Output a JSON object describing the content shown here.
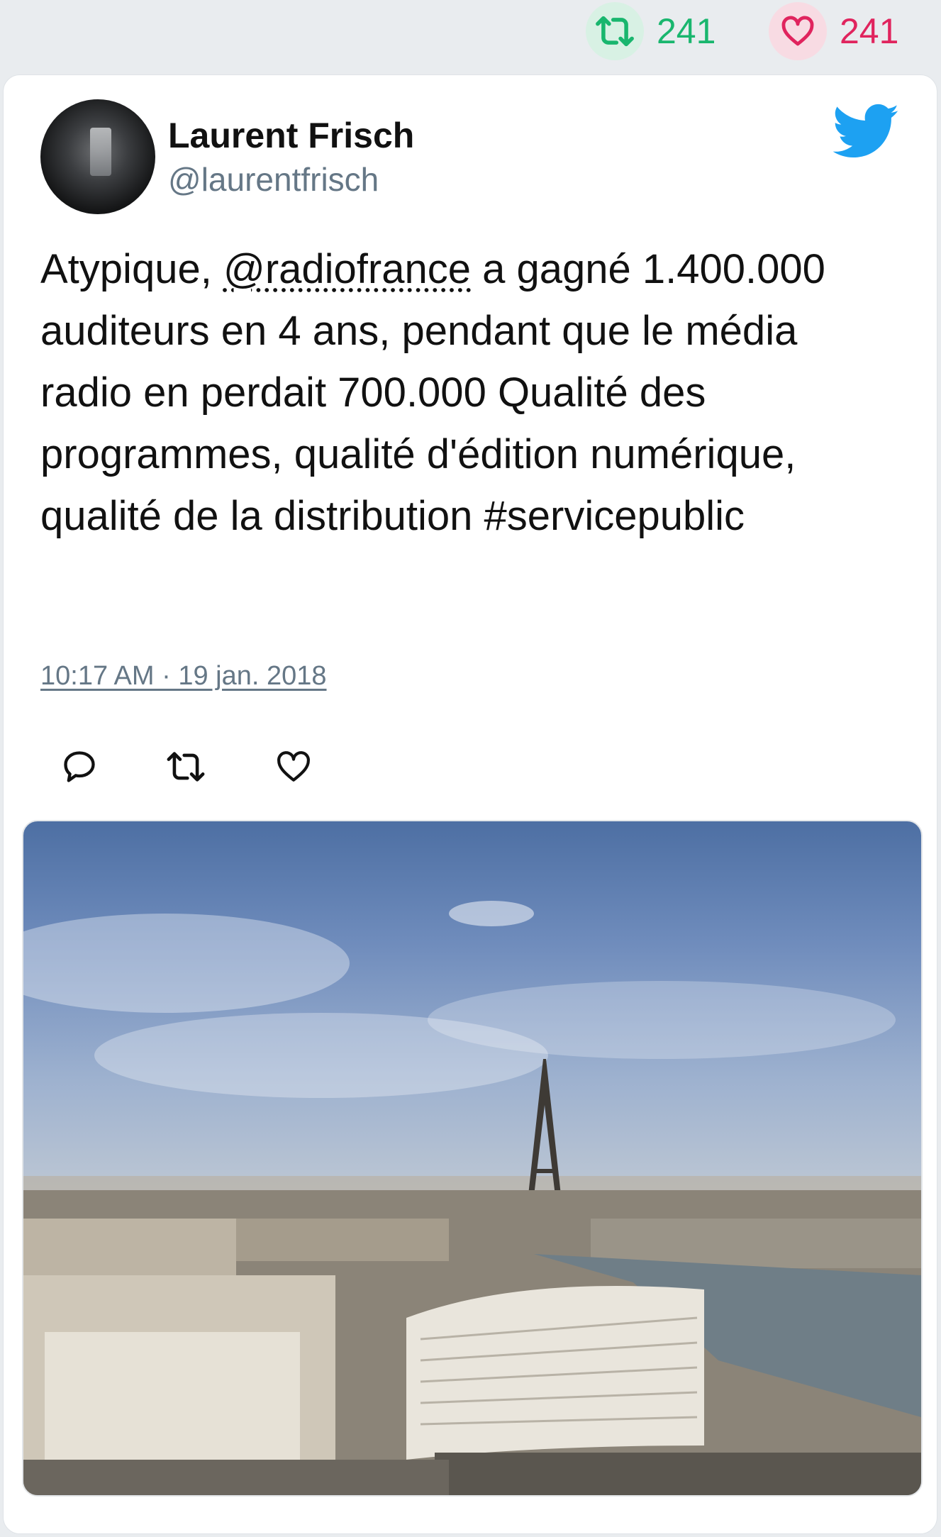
{
  "stats": {
    "retweets": "241",
    "likes": "241"
  },
  "author": {
    "name": "Laurent Frisch",
    "handle": "@laurentfrisch"
  },
  "tweet": {
    "text_before": "Atypique, ",
    "mention": "@radiofrance",
    "text_after": " a gagné 1.400.000 auditeurs en 4 ans, pendant que le média radio en perdait 700.000 Qualité des programmes, qualité d'édition numérique, qualité de la distribution #servicepublic",
    "timestamp": "10:17 AM · 19 jan. 2018"
  },
  "icons": {
    "retweet": "retweet-icon",
    "like": "heart-icon",
    "reply": "reply-icon",
    "brand": "twitter-bird-icon"
  },
  "colors": {
    "retweet": "#19b66e",
    "like": "#e0245e",
    "brand": "#1da1f2",
    "secondary_text": "#657786"
  }
}
